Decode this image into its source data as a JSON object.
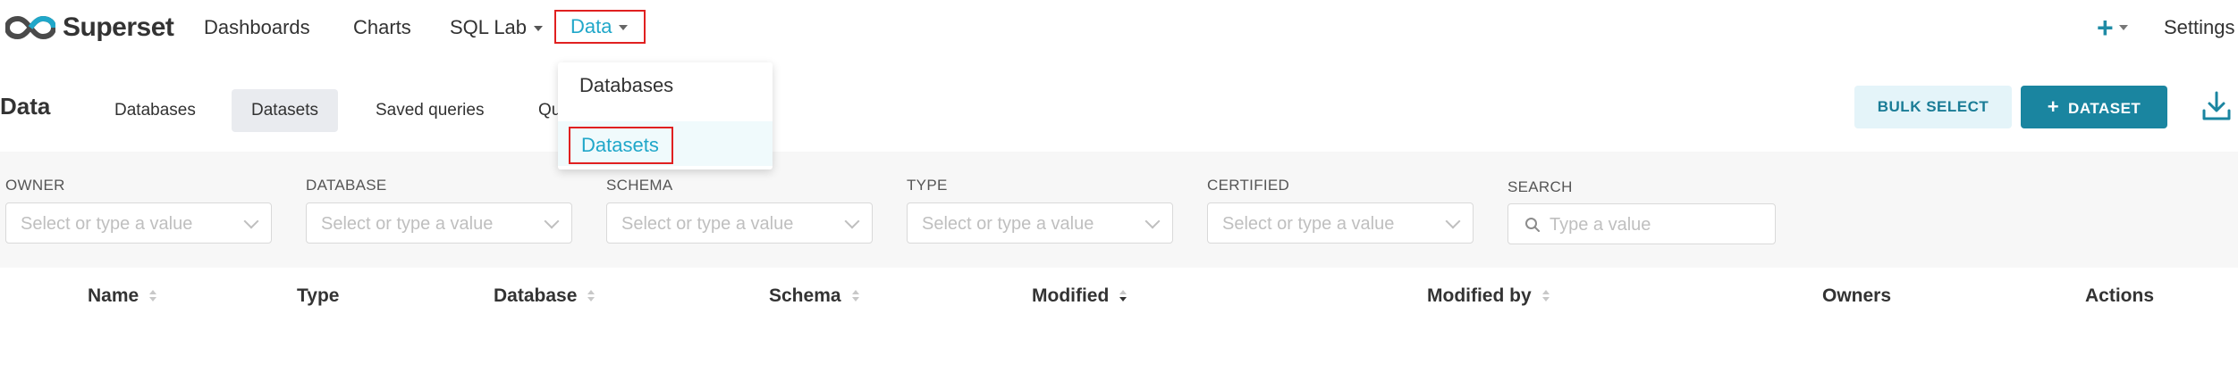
{
  "app": {
    "brand": "Superset"
  },
  "topnav": {
    "items": [
      {
        "label": "Dashboards"
      },
      {
        "label": "Charts"
      },
      {
        "label": "SQL Lab"
      },
      {
        "label": "Data"
      }
    ],
    "settings_label": "Settings",
    "plus_icon": "plus-icon"
  },
  "data_menu": {
    "items": [
      {
        "label": "Databases"
      },
      {
        "label": "Datasets",
        "selected": true
      }
    ]
  },
  "page": {
    "title": "Data",
    "tabs": [
      {
        "label": "Databases"
      },
      {
        "label": "Datasets",
        "active": true
      },
      {
        "label": "Saved queries"
      },
      {
        "label": "Qu"
      }
    ],
    "bulk_select_label": "BULK SELECT",
    "add_dataset_label": "DATASET",
    "download_icon": "download-icon"
  },
  "filters": [
    {
      "label": "OWNER",
      "placeholder": "Select or type a value"
    },
    {
      "label": "DATABASE",
      "placeholder": "Select or type a value"
    },
    {
      "label": "SCHEMA",
      "placeholder": "Select or type a value"
    },
    {
      "label": "TYPE",
      "placeholder": "Select or type a value"
    },
    {
      "label": "CERTIFIED",
      "placeholder": "Select or type a value"
    },
    {
      "label": "SEARCH",
      "placeholder": "Type a value"
    }
  ],
  "table": {
    "columns": [
      {
        "label": "Name",
        "sortable": true
      },
      {
        "label": "Type",
        "sortable": false
      },
      {
        "label": "Database",
        "sortable": true
      },
      {
        "label": "Schema",
        "sortable": true
      },
      {
        "label": "Modified",
        "sortable": true,
        "sorted": "desc"
      },
      {
        "label": "Modified by",
        "sortable": true
      },
      {
        "label": "Owners",
        "sortable": false
      },
      {
        "label": "Actions",
        "sortable": false
      }
    ]
  },
  "colors": {
    "accent": "#20a7c9",
    "primary_button": "#1a85a0",
    "highlight_border": "#e02020"
  }
}
